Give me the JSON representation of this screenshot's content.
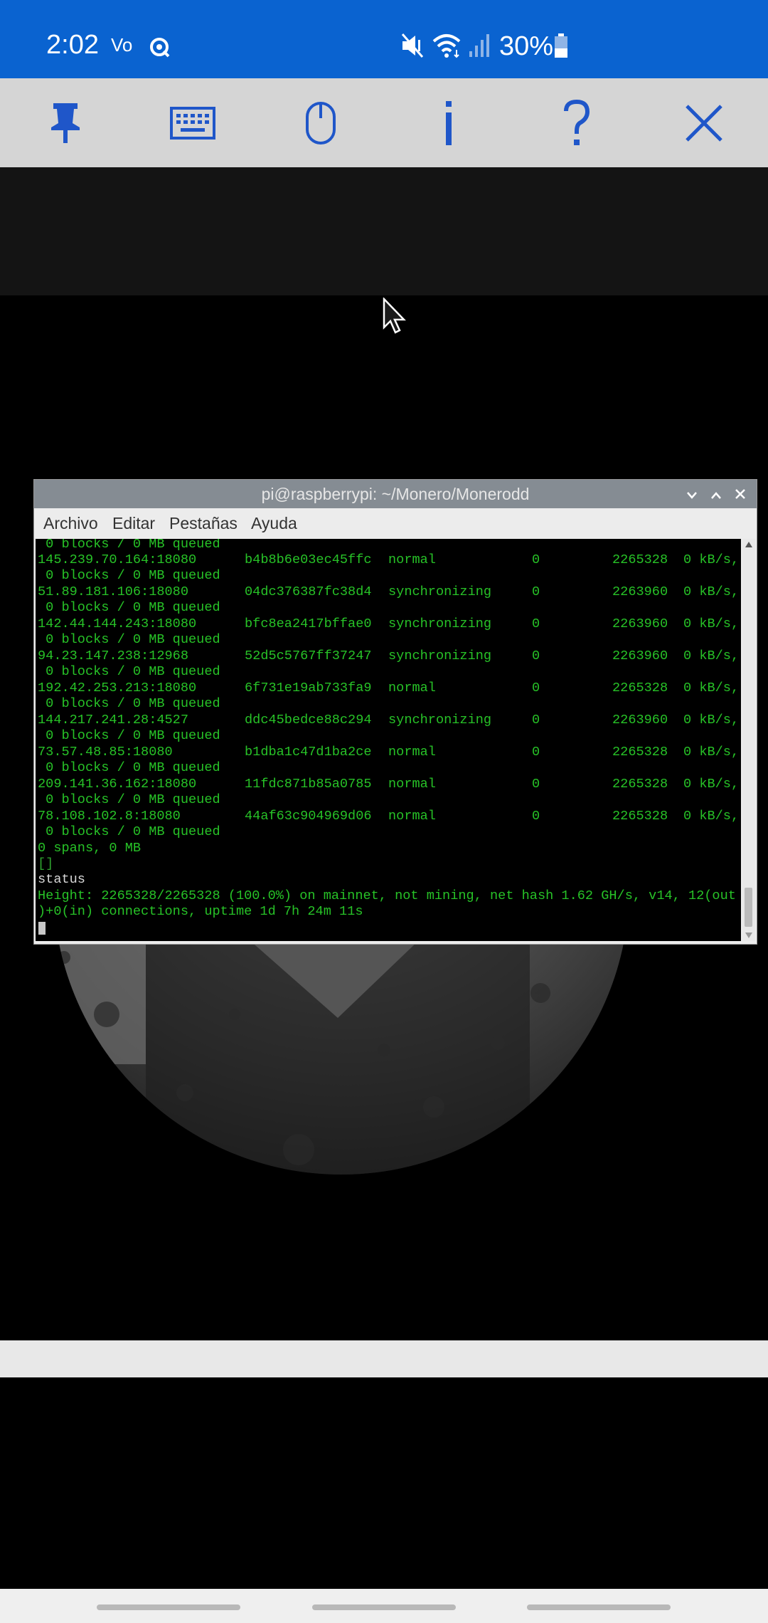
{
  "status_bar": {
    "time": "2:02",
    "volte": "Vo",
    "battery_pct": "30%",
    "icons": [
      "volte-icon",
      "sync-icon",
      "mute-icon",
      "wifi-icon",
      "signal-icon",
      "battery-icon"
    ]
  },
  "toolbar": {
    "buttons": [
      "pin-icon",
      "keyboard-icon",
      "mouse-icon",
      "info-icon",
      "help-icon",
      "close-icon"
    ],
    "color": "#1f56c9"
  },
  "terminal": {
    "title": "pi@raspberrypi: ~/Monero/Monerodd",
    "menu": [
      "Archivo",
      "Editar",
      "Pestañas",
      "Ayuda"
    ],
    "queued": " 0 blocks / 0 MB queued",
    "peers": [
      {
        "addr": "145.239.70.164:18080",
        "id": "b4b8b6e03ec45ffc",
        "state": "normal",
        "n": "0",
        "height": "2265328",
        "rate": "0 kB/s,"
      },
      {
        "addr": "51.89.181.106:18080",
        "id": "04dc376387fc38d4",
        "state": "synchronizing",
        "n": "0",
        "height": "2263960",
        "rate": "0 kB/s,"
      },
      {
        "addr": "142.44.144.243:18080",
        "id": "bfc8ea2417bffae0",
        "state": "synchronizing",
        "n": "0",
        "height": "2263960",
        "rate": "0 kB/s,"
      },
      {
        "addr": "94.23.147.238:12968",
        "id": "52d5c5767ff37247",
        "state": "synchronizing",
        "n": "0",
        "height": "2263960",
        "rate": "0 kB/s,"
      },
      {
        "addr": "192.42.253.213:18080",
        "id": "6f731e19ab733fa9",
        "state": "normal",
        "n": "0",
        "height": "2265328",
        "rate": "0 kB/s,"
      },
      {
        "addr": "144.217.241.28:4527",
        "id": "ddc45bedce88c294",
        "state": "synchronizing",
        "n": "0",
        "height": "2263960",
        "rate": "0 kB/s,"
      },
      {
        "addr": "73.57.48.85:18080",
        "id": "b1dba1c47d1ba2ce",
        "state": "normal",
        "n": "0",
        "height": "2265328",
        "rate": "0 kB/s,"
      },
      {
        "addr": "209.141.36.162:18080",
        "id": "11fdc871b85a0785",
        "state": "normal",
        "n": "0",
        "height": "2265328",
        "rate": "0 kB/s,"
      },
      {
        "addr": "78.108.102.8:18080",
        "id": "44af63c904969d06",
        "state": "normal",
        "n": "0",
        "height": "2265328",
        "rate": "0 kB/s,"
      }
    ],
    "spans": "0 spans, 0 MB",
    "brackets": "[]",
    "command": "status",
    "status_line1": "Height: 2265328/2265328 (100.0%) on mainnet, not mining, net hash 1.62 GH/s, v14, 12(out",
    "status_line2": ")+0(in) connections, uptime 1d 7h 24m 11s"
  }
}
